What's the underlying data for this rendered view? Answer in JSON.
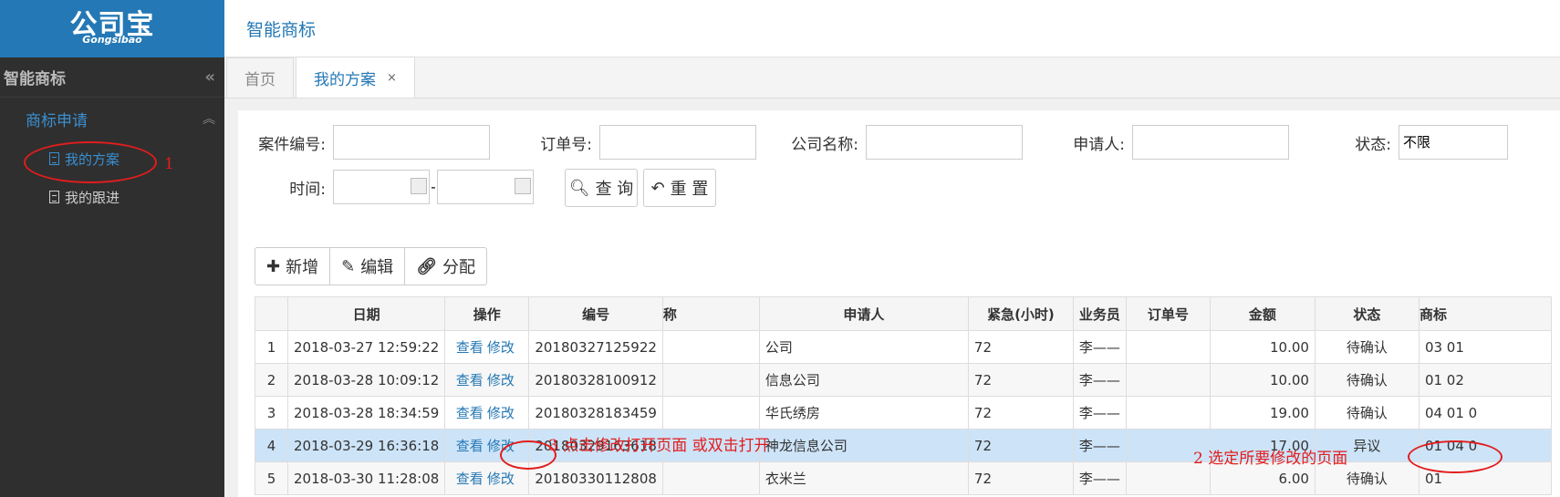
{
  "logo": {
    "main": "公司宝",
    "sub": "Gongsibao"
  },
  "sidebar": {
    "title": "智能商标",
    "group": "商标申请",
    "items": [
      {
        "label": "我的方案"
      },
      {
        "label": "我的跟进"
      }
    ]
  },
  "topbar": {
    "title": "智能商标"
  },
  "tabs": [
    {
      "label": "首页"
    },
    {
      "label": "我的方案",
      "close": "×"
    }
  ],
  "filters": {
    "case_no": "案件编号:",
    "order_no": "订单号:",
    "company": "公司名称:",
    "applicant": "申请人:",
    "status": "状态:",
    "status_value": "不限",
    "time": "时间:",
    "dash": "-",
    "query": "查 询",
    "reset": "重 置"
  },
  "toolbar": {
    "add": "新增",
    "edit": "编辑",
    "assign": "分配"
  },
  "table": {
    "headers": [
      "",
      "日期",
      "操作",
      "编号",
      "称",
      "申请人",
      "紧急(小时)",
      "业务员",
      "订单号",
      "金额",
      "状态",
      "商标"
    ],
    "view": "查看",
    "modify": "修改",
    "rows": [
      [
        "1",
        "2018-03-27 12:59:22",
        "20180327125922",
        "",
        "公司",
        "72",
        "李——",
        "",
        "10.00",
        "待确认",
        "03 01"
      ],
      [
        "2",
        "2018-03-28 10:09:12",
        "20180328100912",
        "",
        "信息公司",
        "72",
        "李——",
        "",
        "10.00",
        "待确认",
        "01 02"
      ],
      [
        "3",
        "2018-03-28 18:34:59",
        "20180328183459",
        "",
        "华氏绣房",
        "72",
        "李——",
        "",
        "19.00",
        "待确认",
        "04 01 0"
      ],
      [
        "4",
        "2018-03-29 16:36:18",
        "20180329163618",
        "",
        "神龙信息公司",
        "72",
        "李——",
        "",
        "17.00",
        "异议",
        "01 04 0"
      ],
      [
        "5",
        "2018-03-30 11:28:08",
        "20180330112808",
        "",
        "衣米兰",
        "72",
        "李——",
        "",
        "6.00",
        "待确认",
        "01"
      ]
    ]
  },
  "annotations": {
    "a1": "1",
    "a2": "2  选定所要修改的页面",
    "a3": "3  点击修改打开页面  或双击打开"
  },
  "colors": {
    "sidebar_bg": "#2f2f2f",
    "logo_bg": "#2478b5",
    "accent": "#2478b5",
    "annotation": "#e21d1d",
    "selected_row": "#cde4f8"
  }
}
